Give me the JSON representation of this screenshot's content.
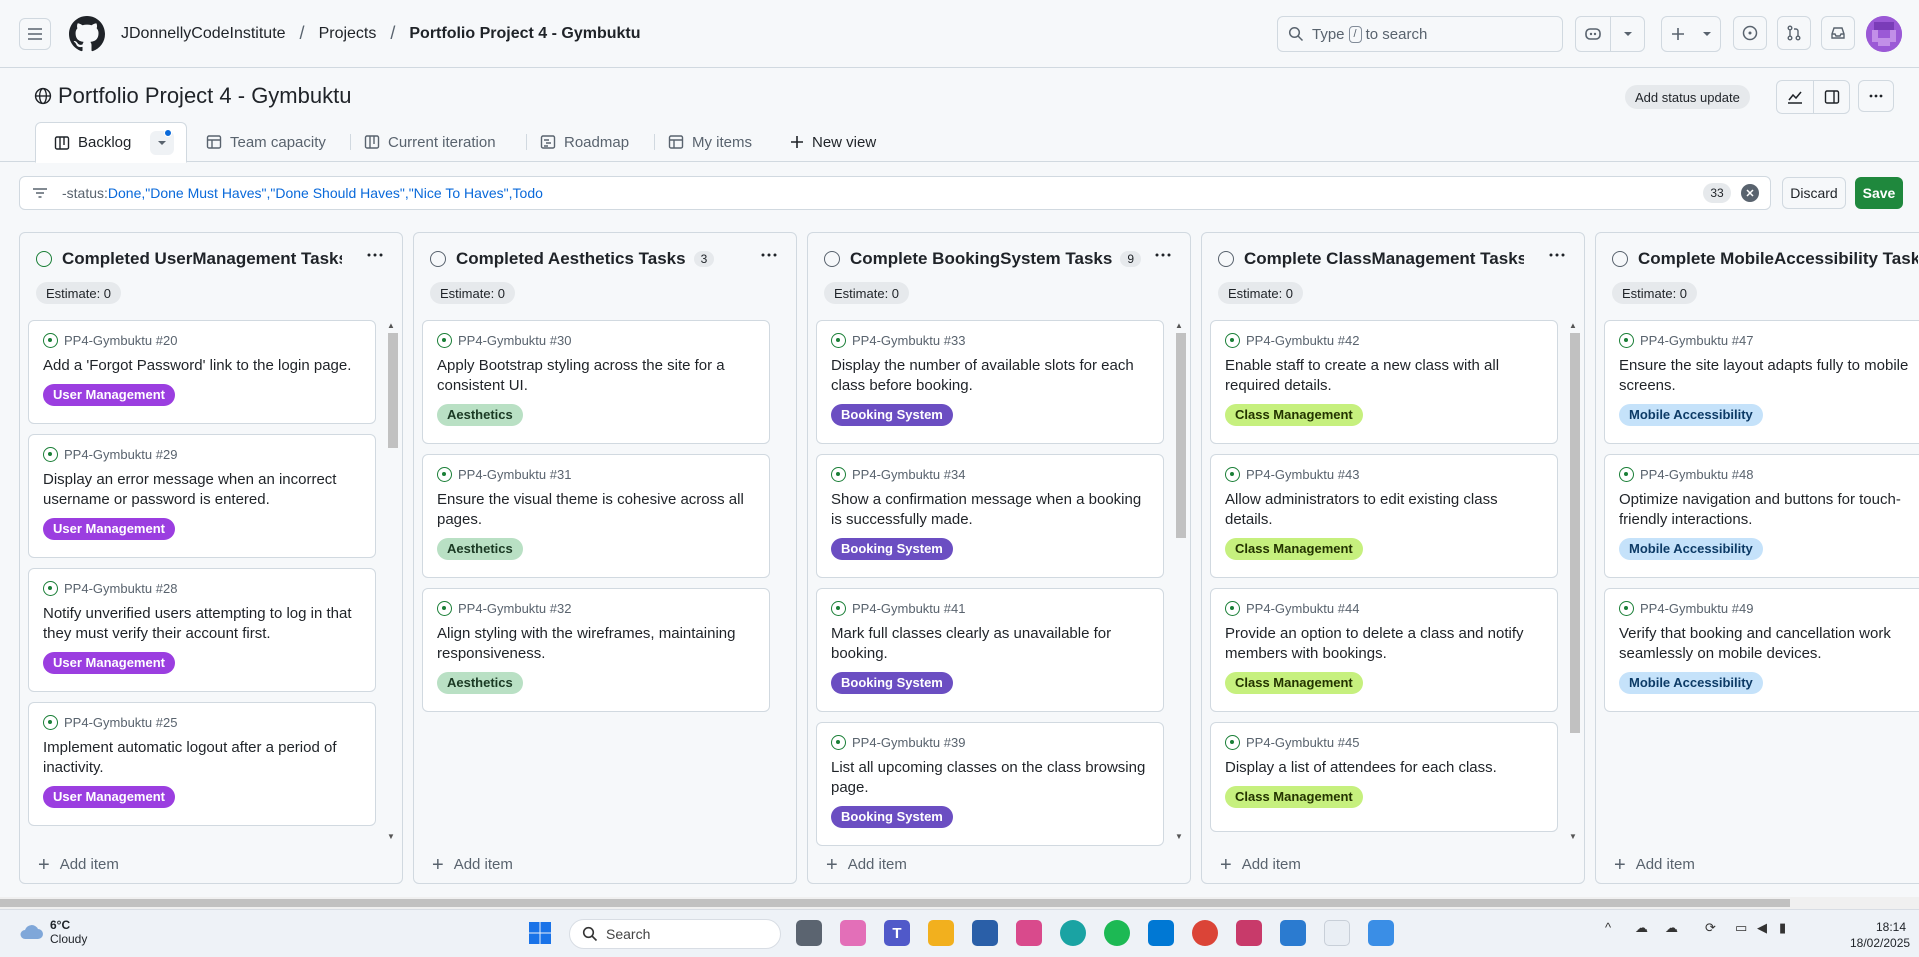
{
  "header": {
    "breadcrumbs": [
      "JDonnellyCodeInstitute",
      "Projects",
      "Portfolio Project 4 - Gymbuktu"
    ],
    "search_prefix": "Type",
    "search_key": "/",
    "search_suffix": "to search"
  },
  "project": {
    "title": "Portfolio Project 4 - Gymbuktu",
    "status_button": "Add status update"
  },
  "tabs": [
    {
      "label": "Backlog",
      "icon": "board-icon"
    },
    {
      "label": "Team capacity",
      "icon": "table-icon"
    },
    {
      "label": "Current iteration",
      "icon": "board-icon"
    },
    {
      "label": "Roadmap",
      "icon": "roadmap-icon"
    },
    {
      "label": "My items",
      "icon": "table-icon"
    },
    {
      "label": "New view",
      "icon": "plus-icon"
    }
  ],
  "filter": {
    "prefix": "-status:",
    "values": "Done,\"Done Must Haves\",\"Done Should Haves\",\"Nice To Haves\",Todo",
    "count": "33",
    "discard": "Discard",
    "save": "Save"
  },
  "columns": [
    {
      "name": "Completed UserManagement Tasks",
      "count": "",
      "estimate": "Estimate: 0",
      "status_color": "green",
      "cards": [
        {
          "ref": "PP4-Gymbuktu #20",
          "title": "Add a 'Forgot Password' link to the login page.",
          "label": "User Management",
          "label_class": "lab-um"
        },
        {
          "ref": "PP4-Gymbuktu #29",
          "title": "Display an error message when an incorrect username or password is entered.",
          "label": "User Management",
          "label_class": "lab-um"
        },
        {
          "ref": "PP4-Gymbuktu #28",
          "title": "Notify unverified users attempting to log in that they must verify their account first.",
          "label": "User Management",
          "label_class": "lab-um"
        },
        {
          "ref": "PP4-Gymbuktu #25",
          "title": "Implement automatic logout after a period of inactivity.",
          "label": "User Management",
          "label_class": "lab-um"
        }
      ]
    },
    {
      "name": "Completed Aesthetics Tasks",
      "count": "3",
      "estimate": "Estimate: 0",
      "status_color": "gray",
      "cards": [
        {
          "ref": "PP4-Gymbuktu #30",
          "title": "Apply Bootstrap styling across the site for a consistent UI.",
          "label": "Aesthetics",
          "label_class": "lab-ae"
        },
        {
          "ref": "PP4-Gymbuktu #31",
          "title": "Ensure the visual theme is cohesive across all pages.",
          "label": "Aesthetics",
          "label_class": "lab-ae"
        },
        {
          "ref": "PP4-Gymbuktu #32",
          "title": "Align styling with the wireframes, maintaining responsiveness.",
          "label": "Aesthetics",
          "label_class": "lab-ae"
        }
      ]
    },
    {
      "name": "Complete BookingSystem Tasks",
      "count": "9",
      "estimate": "Estimate: 0",
      "status_color": "gray",
      "cards": [
        {
          "ref": "PP4-Gymbuktu #33",
          "title": "Display the number of available slots for each class before booking.",
          "label": "Booking System",
          "label_class": "lab-bs"
        },
        {
          "ref": "PP4-Gymbuktu #34",
          "title": "Show a confirmation message when a booking is successfully made.",
          "label": "Booking System",
          "label_class": "lab-bs"
        },
        {
          "ref": "PP4-Gymbuktu #41",
          "title": "Mark full classes clearly as unavailable for booking.",
          "label": "Booking System",
          "label_class": "lab-bs"
        },
        {
          "ref": "PP4-Gymbuktu #39",
          "title": "List all upcoming classes on the class browsing page.",
          "label": "Booking System",
          "label_class": "lab-bs"
        }
      ]
    },
    {
      "name": "Complete ClassManagement Tasks",
      "count": "",
      "estimate": "Estimate: 0",
      "status_color": "gray",
      "cards": [
        {
          "ref": "PP4-Gymbuktu #42",
          "title": "Enable staff to create a new class with all required details.",
          "label": "Class Management",
          "label_class": "lab-cm"
        },
        {
          "ref": "PP4-Gymbuktu #43",
          "title": "Allow administrators to edit existing class details.",
          "label": "Class Management",
          "label_class": "lab-cm"
        },
        {
          "ref": "PP4-Gymbuktu #44",
          "title": "Provide an option to delete a class and notify members with bookings.",
          "label": "Class Management",
          "label_class": "lab-cm"
        },
        {
          "ref": "PP4-Gymbuktu #45",
          "title": "Display a list of attendees for each class.",
          "label": "Class Management",
          "label_class": "lab-cm"
        }
      ]
    },
    {
      "name": "Complete MobileAccessibility Tasks",
      "count": "",
      "estimate": "Estimate: 0",
      "status_color": "gray",
      "cards": [
        {
          "ref": "PP4-Gymbuktu #47",
          "title": "Ensure the site layout adapts fully to mobile screens.",
          "label": "Mobile Accessibility",
          "label_class": "lab-ma"
        },
        {
          "ref": "PP4-Gymbuktu #48",
          "title": "Optimize navigation and buttons for touch-friendly interactions.",
          "label": "Mobile Accessibility",
          "label_class": "lab-ma"
        },
        {
          "ref": "PP4-Gymbuktu #49",
          "title": "Verify that booking and cancellation work seamlessly on mobile devices.",
          "label": "Mobile Accessibility",
          "label_class": "lab-ma"
        }
      ]
    }
  ],
  "add_item_label": "Add item",
  "taskbar": {
    "weather_temp": "6°C",
    "weather_desc": "Cloudy",
    "search": "Search",
    "time": "18:14",
    "date": "18/02/2025"
  }
}
